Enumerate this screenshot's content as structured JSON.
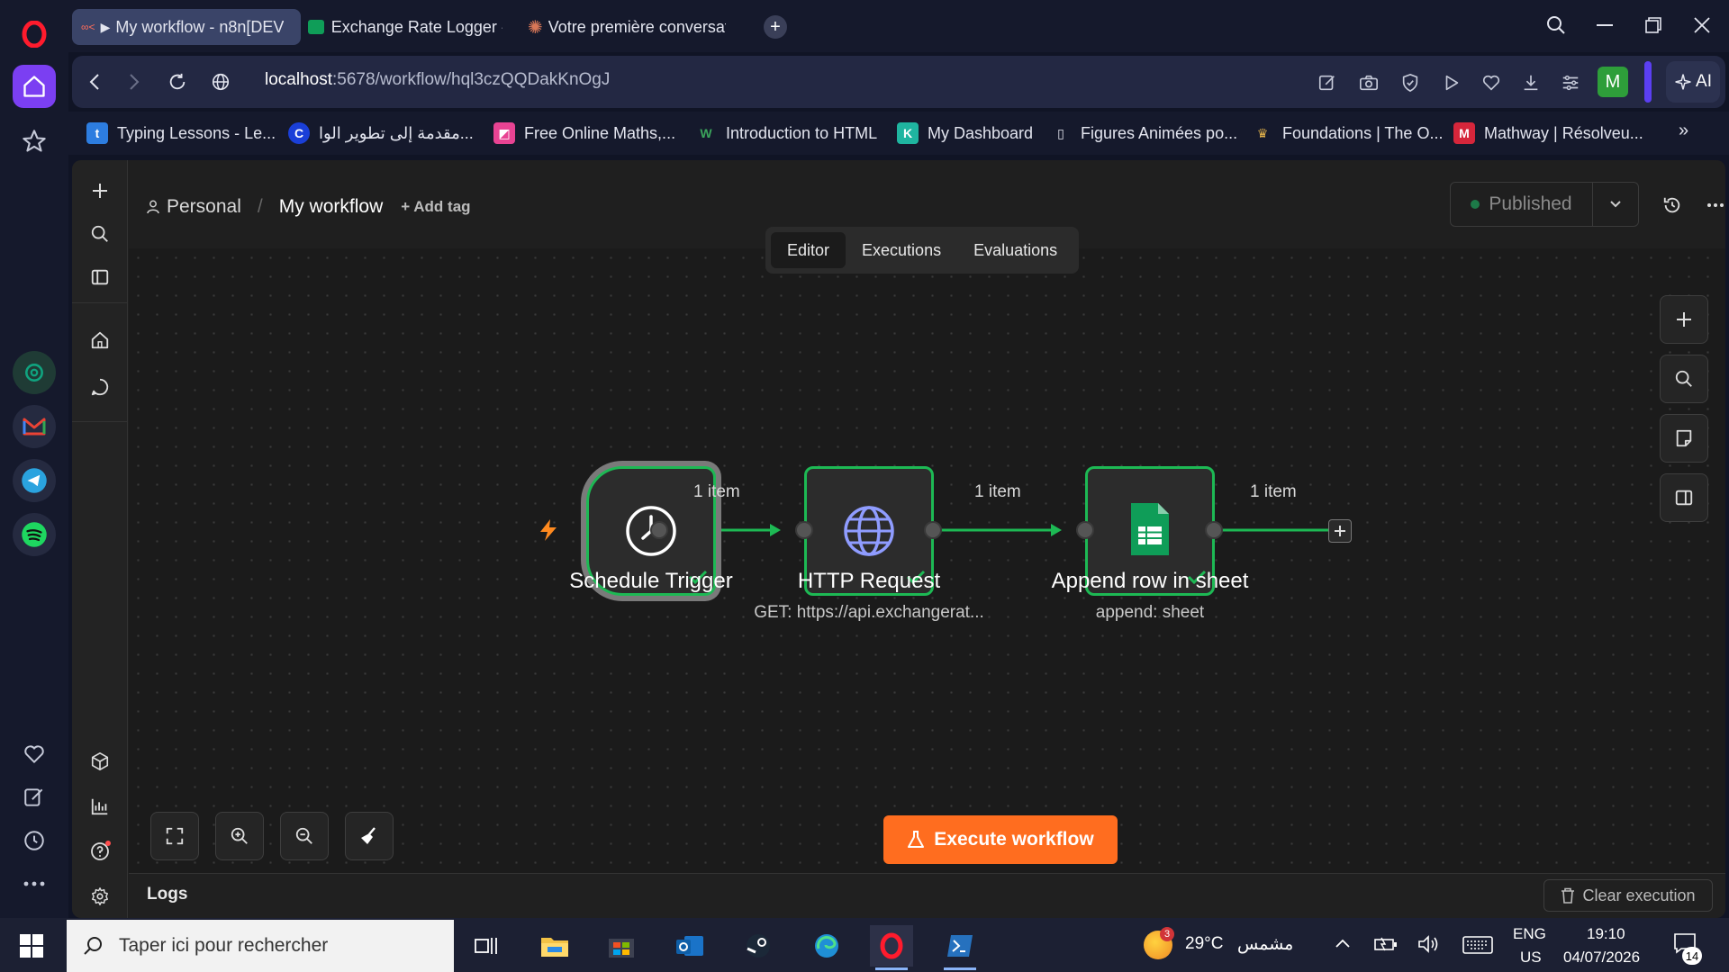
{
  "browser": {
    "tabs": [
      {
        "title": "My workflow - n8n[DEV",
        "active": true
      },
      {
        "title": "Exchange Rate Logger - G",
        "active": false
      },
      {
        "title": "Votre première conversati",
        "active": false
      }
    ],
    "url_host": "localhost",
    "url_path": ":5678/workflow/hql3czQQDakKnOgJ",
    "profile_initial": "M",
    "ai_label": "AI",
    "bookmarks": [
      {
        "label": "Typing Lessons - Le...",
        "icon_color": "#2d7de0",
        "glyph": "t"
      },
      {
        "label": "مقدمة إلى تطوير الوا...",
        "icon_color": "#1a3fd8",
        "glyph": "C"
      },
      {
        "label": "Free Online Maths,...",
        "icon_color": "#e84393",
        "glyph": "◩"
      },
      {
        "label": "Introduction to HTML",
        "icon_color": "#15192c",
        "glyph": "W"
      },
      {
        "label": "My Dashboard",
        "icon_color": "#1fb5a0",
        "glyph": "K"
      },
      {
        "label": "Figures Animées po...",
        "icon_color": "#15192c",
        "glyph": "▯"
      },
      {
        "label": "Foundations | The O...",
        "icon_color": "#15192c",
        "glyph": "♛"
      },
      {
        "label": "Mathway | Résolveu...",
        "icon_color": "#d6263b",
        "glyph": "M"
      }
    ]
  },
  "n8n": {
    "breadcrumb_project": "Personal",
    "breadcrumb_sep": "/",
    "workflow_name": "My workflow",
    "add_tag": "+ Add tag",
    "status": "Published",
    "tabs": [
      "Editor",
      "Executions",
      "Evaluations"
    ],
    "active_tab": "Editor",
    "nodes": [
      {
        "name": "Schedule Trigger",
        "subtitle": ""
      },
      {
        "name": "HTTP Request",
        "subtitle": "GET: https://api.exchangerat..."
      },
      {
        "name": "Append row in sheet",
        "subtitle": "append: sheet"
      }
    ],
    "connection_labels": [
      "1 item",
      "1 item",
      "1 item"
    ],
    "execute_button": "Execute workflow",
    "logs_label": "Logs",
    "clear_execution": "Clear execution",
    "accent_green": "#1db954",
    "accent_orange": "#ff6d1f"
  },
  "taskbar": {
    "search_placeholder": "Taper ici pour rechercher",
    "weather_temp": "29°C",
    "weather_label": "مشمس",
    "weather_badge": "3",
    "lang_top": "ENG",
    "lang_bottom": "US",
    "time": "19:10",
    "date": "04/07/2026",
    "notification_count": "14"
  }
}
